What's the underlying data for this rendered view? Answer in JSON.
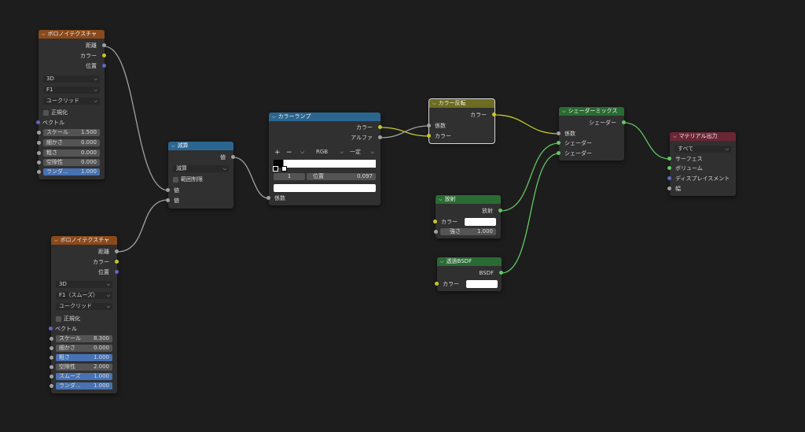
{
  "nodes": {
    "voronoi1": {
      "title": "ボロノイテクスチャ",
      "outputs": [
        "距離",
        "カラー",
        "位置"
      ],
      "dims": "3D",
      "feature": "F1",
      "metric": "ユークリッド",
      "normalize": "正規化",
      "vector": "ベクトル",
      "params": [
        {
          "label": "スケール",
          "value": "1.500"
        },
        {
          "label": "細かさ",
          "value": "0.000"
        },
        {
          "label": "粗さ",
          "value": "0.000"
        },
        {
          "label": "空隙性",
          "value": "0.000"
        },
        {
          "label": "ランダ...",
          "value": "1.000"
        }
      ]
    },
    "voronoi2": {
      "title": "ボロノイテクスチャ",
      "outputs": [
        "距離",
        "カラー",
        "位置"
      ],
      "dims": "3D",
      "feature": "F1（スムーズ）",
      "metric": "ユークリッド",
      "normalize": "正規化",
      "vector": "ベクトル",
      "params": [
        {
          "label": "スケール",
          "value": "8.300"
        },
        {
          "label": "細かさ",
          "value": "0.000"
        },
        {
          "label": "粗さ",
          "value": "1.000"
        },
        {
          "label": "空隙性",
          "value": "2.000"
        },
        {
          "label": "スムーズ",
          "value": "1.000"
        },
        {
          "label": "ランダ...",
          "value": "1.000"
        }
      ]
    },
    "math": {
      "title": "減算",
      "output": "値",
      "operation": "減算",
      "clamp": "範囲制限",
      "inputs": [
        "値",
        "値"
      ]
    },
    "ramp": {
      "title": "カラーランプ",
      "outputs": [
        "カラー",
        "アルファ"
      ],
      "add": "+",
      "remove": "−",
      "mode": "RGB",
      "interp": "一定",
      "stop_index": "1",
      "pos_label": "位置",
      "pos_value": "0.097",
      "input": "係数"
    },
    "invert": {
      "title": "カラー反転",
      "output": "カラー",
      "inputs": [
        "係数",
        "カラー"
      ]
    },
    "mix": {
      "title": "シェーダーミックス",
      "output": "シェーダー",
      "inputs": [
        "係数",
        "シェーダー",
        "シェーダー"
      ]
    },
    "emission": {
      "title": "放射",
      "output": "放射",
      "color_label": "カラー",
      "strength_label": "強さ",
      "strength_value": "1.000"
    },
    "transparent": {
      "title": "透過BSDF",
      "output": "BSDF",
      "color_label": "カラー"
    },
    "output": {
      "title": "マテリアル出力",
      "target": "すべて",
      "inputs": [
        "サーフェス",
        "ボリューム",
        "ディスプレイスメント",
        "幅"
      ]
    }
  }
}
